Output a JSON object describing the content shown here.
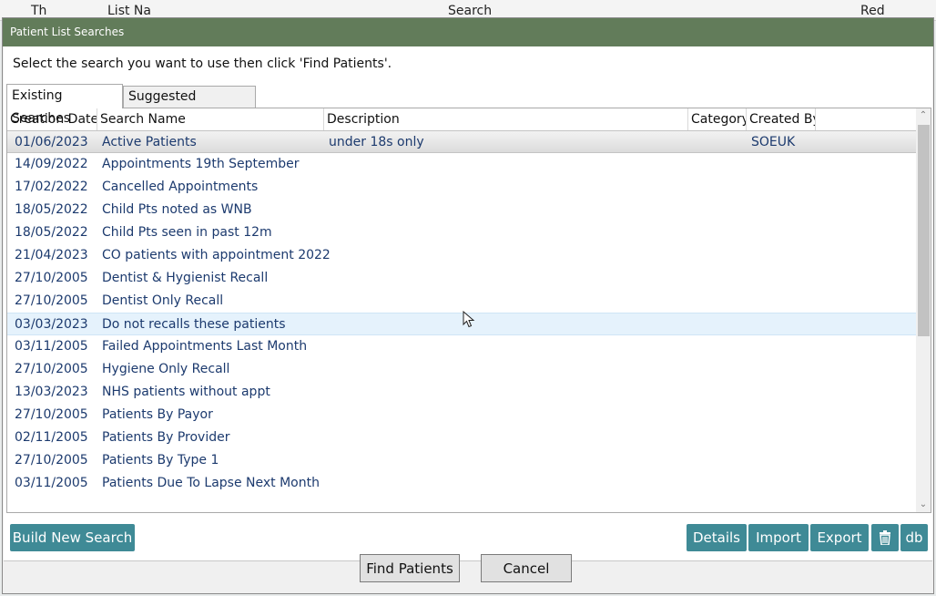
{
  "background_header": [
    "Th",
    "List Na",
    "Search",
    "Red"
  ],
  "dialog": {
    "title": "Patient List Searches",
    "instruction": "Select the search you want to use then click 'Find Patients'."
  },
  "tabs": [
    {
      "label": "Existing Searches",
      "active": true
    },
    {
      "label": "Suggested Searches",
      "active": false
    }
  ],
  "grid": {
    "columns": [
      "Creation Date",
      "Search Name",
      "Description",
      "Category",
      "Created By"
    ],
    "rows": [
      {
        "date": "01/06/2023",
        "name": "Active Patients",
        "description": "under 18s only",
        "category": "",
        "created_by": "SOEUK"
      },
      {
        "date": "14/09/2022",
        "name": "Appointments 19th September",
        "description": "",
        "category": "",
        "created_by": ""
      },
      {
        "date": "17/02/2022",
        "name": "Cancelled Appointments",
        "description": "",
        "category": "",
        "created_by": ""
      },
      {
        "date": "18/05/2022",
        "name": "Child Pts noted as WNB",
        "description": "",
        "category": "",
        "created_by": ""
      },
      {
        "date": "18/05/2022",
        "name": "Child Pts seen in past 12m",
        "description": "",
        "category": "",
        "created_by": ""
      },
      {
        "date": "21/04/2023",
        "name": "CO patients with appointment 2022",
        "description": "",
        "category": "",
        "created_by": ""
      },
      {
        "date": "27/10/2005",
        "name": "Dentist & Hygienist Recall",
        "description": "",
        "category": "",
        "created_by": ""
      },
      {
        "date": "27/10/2005",
        "name": "Dentist Only Recall",
        "description": "",
        "category": "",
        "created_by": ""
      },
      {
        "date": "03/03/2023",
        "name": "Do not recalls these patients",
        "description": "",
        "category": "",
        "created_by": ""
      },
      {
        "date": "03/11/2005",
        "name": "Failed Appointments Last Month",
        "description": "",
        "category": "",
        "created_by": ""
      },
      {
        "date": "27/10/2005",
        "name": "Hygiene Only Recall",
        "description": "",
        "category": "",
        "created_by": ""
      },
      {
        "date": "13/03/2023",
        "name": "NHS patients without appt",
        "description": "",
        "category": "",
        "created_by": ""
      },
      {
        "date": "27/10/2005",
        "name": "Patients By Payor",
        "description": "",
        "category": "",
        "created_by": ""
      },
      {
        "date": "02/11/2005",
        "name": "Patients By Provider",
        "description": "",
        "category": "",
        "created_by": ""
      },
      {
        "date": "27/10/2005",
        "name": "Patients By Type 1",
        "description": "",
        "category": "",
        "created_by": ""
      },
      {
        "date": "03/11/2005",
        "name": "Patients Due To Lapse Next Month",
        "description": "",
        "category": "",
        "created_by": ""
      }
    ],
    "selected_index": 0,
    "hover_index": 8
  },
  "buttons": {
    "build_new_search": "Build New Search",
    "details": "Details",
    "import": "Import",
    "export": "Export",
    "delete_icon": "trash-icon",
    "db": "db",
    "find_patients": "Find Patients",
    "cancel": "Cancel"
  },
  "colors": {
    "titlebar": "#627c5a",
    "teal_button": "#3f8a96",
    "row_text": "#1c3a6e"
  }
}
